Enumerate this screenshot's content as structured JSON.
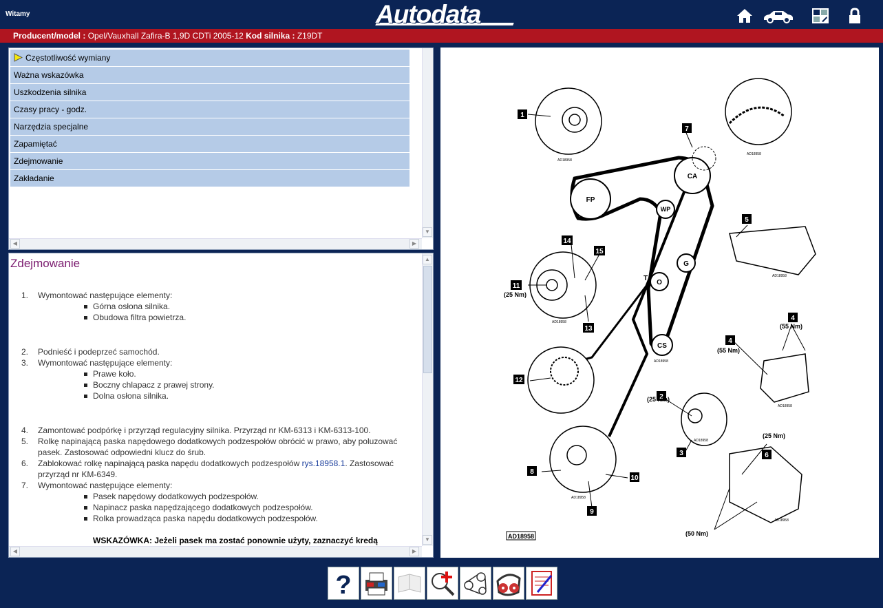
{
  "header": {
    "welcome": "Witamy",
    "logo": "Autodata",
    "icons": [
      "home-icon",
      "car-icon",
      "vehicle-select-icon",
      "lock-icon"
    ]
  },
  "vehicle": {
    "model_label": "Producent/model :",
    "model_value": "Opel/Vauxhall Zafira-B 1,9D CDTi 2005-12",
    "engine_label": "Kod silnika :",
    "engine_value": "Z19DT"
  },
  "menu": {
    "items": [
      {
        "label": "Częstotliwość wymiany",
        "active": true
      },
      {
        "label": "Ważna wskazówka"
      },
      {
        "label": "Uszkodzenia silnika"
      },
      {
        "label": "Czasy pracy - godz."
      },
      {
        "label": "Narzędzia specjalne"
      },
      {
        "label": "Zapamiętać"
      },
      {
        "label": "Zdejmowanie"
      },
      {
        "label": "Zakładanie"
      }
    ]
  },
  "content": {
    "title": "Zdejmowanie",
    "step1": "Wymontować następujące elementy:",
    "step1_subs": [
      "Górna osłona silnika.",
      "Obudowa filtra powietrza."
    ],
    "step2": "Podnieść i podeprzeć samochód.",
    "step3": "Wymontować następujące elementy:",
    "step3_subs": [
      "Prawe koło.",
      "Boczny chlapacz z prawej strony.",
      "Dolna osłona silnika."
    ],
    "step4": "Zamontować podpórkę i przyrząd regulacyjny silnika. Przyrząd nr KM-6313 i KM-6313-100.",
    "step5": "Rolkę napinającą paska napędowego dodatkowych podzespołów obrócić w prawo, aby poluzować pasek. Zastosować odpowiedni klucz do śrub.",
    "step6_a": "Zablokować rolkę napinającą paska napędu dodatkowych podzespołów ",
    "step6_link": "rys.18958.1",
    "step6_b": ". Zastosować przyrząd nr KM-6349.",
    "step7": "Wymontować następujące elementy:",
    "step7_subs": [
      "Pasek napędowy dodatkowych podzespołów.",
      "Napinacz paska napędzającego dodatkowych podzespołów.",
      "Rolka prowadząca paska napędu dodatkowych podzespołów."
    ],
    "note": "WSKAZÓWKA: Jeżeli pasek ma zostać ponownie użyty, zaznaczyć kredą"
  },
  "diagram": {
    "ref": "AD18958",
    "thumb_ref": "AD18958",
    "pulleys": [
      "FP",
      "CA",
      "WP",
      "G",
      "O",
      "CS",
      "T"
    ],
    "callouts": [
      "1",
      "2",
      "3",
      "4",
      "5",
      "6",
      "7",
      "8",
      "9",
      "10",
      "11",
      "12",
      "13",
      "14",
      "15"
    ],
    "torques": {
      "t2": "(25 Nm)",
      "t4a": "(55 Nm)",
      "t4b": "(55 Nm)",
      "t6a": "(25 Nm)",
      "t6b": "(50 Nm)",
      "t11": "(25 Nm)"
    }
  },
  "toolbar": {
    "tools": [
      "help-icon",
      "print-icon",
      "notes-icon",
      "zoom-icon",
      "belt-icon",
      "timing-belt-icon",
      "checklist-icon"
    ]
  }
}
